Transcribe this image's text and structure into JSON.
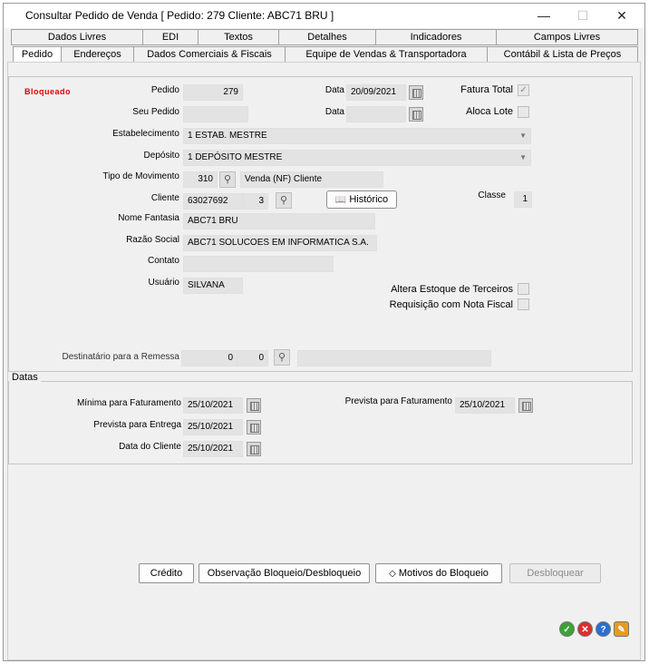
{
  "window": {
    "title": "Consultar Pedido de Venda [ Pedido: 279 Cliente: ABC71 BRU ]",
    "minimize": "—",
    "maximize": "☐",
    "close": "✕"
  },
  "tabs_row1": [
    "Dados Livres",
    "EDI",
    "Textos",
    "Detalhes",
    "Indicadores",
    "Campos Livres"
  ],
  "tabs_row2": [
    "Pedido",
    "Endereços",
    "Dados Comerciais & Fiscais",
    "Equipe de Vendas & Transportadora",
    "Contábil & Lista de Preços"
  ],
  "status": "Bloqueado",
  "form": {
    "pedido_label": "Pedido",
    "pedido_value": "279",
    "data_label": "Data",
    "data_value": "20/09/2021",
    "fatura_total_label": "Fatura Total",
    "seu_pedido_label": "Seu Pedido",
    "seu_pedido_value": "",
    "data2_label": "Data",
    "data2_value": "",
    "aloca_lote_label": "Aloca Lote",
    "estabelecimento_label": "Estabelecimento",
    "estabelecimento_value": "1 ESTAB. MESTRE",
    "deposito_label": "Depósito",
    "deposito_value": "1 DEPÓSITO MESTRE",
    "tipo_mov_label": "Tipo de Movimento",
    "tipo_mov_code": "310",
    "tipo_mov_desc": "Venda (NF) Cliente",
    "cliente_label": "Cliente",
    "cliente_code": "63027692",
    "cliente_seq": "3",
    "historico_label": "Histórico",
    "classe_label": "Classe",
    "classe_value": "1",
    "nome_fantasia_label": "Nome Fantasia",
    "nome_fantasia_value": "ABC71 BRU",
    "razao_social_label": "Razão Social",
    "razao_social_value": "ABC71 SOLUCOES EM INFORMATICA S.A.",
    "contato_label": "Contato",
    "contato_value": "",
    "usuario_label": "Usuário",
    "usuario_value": "SILVANA",
    "altera_estoque_label": "Altera Estoque de Terceiros",
    "requisicao_label": "Requisição com Nota Fiscal",
    "destinatario_label": "Destinatário para a Remessa",
    "dest_v1": "0",
    "dest_v2": "0",
    "dest_desc": ""
  },
  "datas": {
    "caption": "Datas",
    "minima_label": "Mínima para Faturamento",
    "minima_value": "25/10/2021",
    "prevista_fat_label": "Prevista para Faturamento",
    "prevista_fat_value": "25/10/2021",
    "prevista_ent_label": "Prevista para Entrega",
    "prevista_ent_value": "25/10/2021",
    "data_cliente_label": "Data do Cliente",
    "data_cliente_value": "25/10/2021"
  },
  "buttons": {
    "credito": "Crédito",
    "observacao": "Observação Bloqueio/Desbloqueio",
    "motivos": "Motivos do Bloqueio",
    "desbloquear": "Desbloquear"
  },
  "colors": {
    "status_red": "#e00000",
    "ok_green": "#3aa335",
    "cancel_red": "#d83030",
    "help_blue": "#2a6fd1",
    "tool_orange": "#e89a20"
  }
}
